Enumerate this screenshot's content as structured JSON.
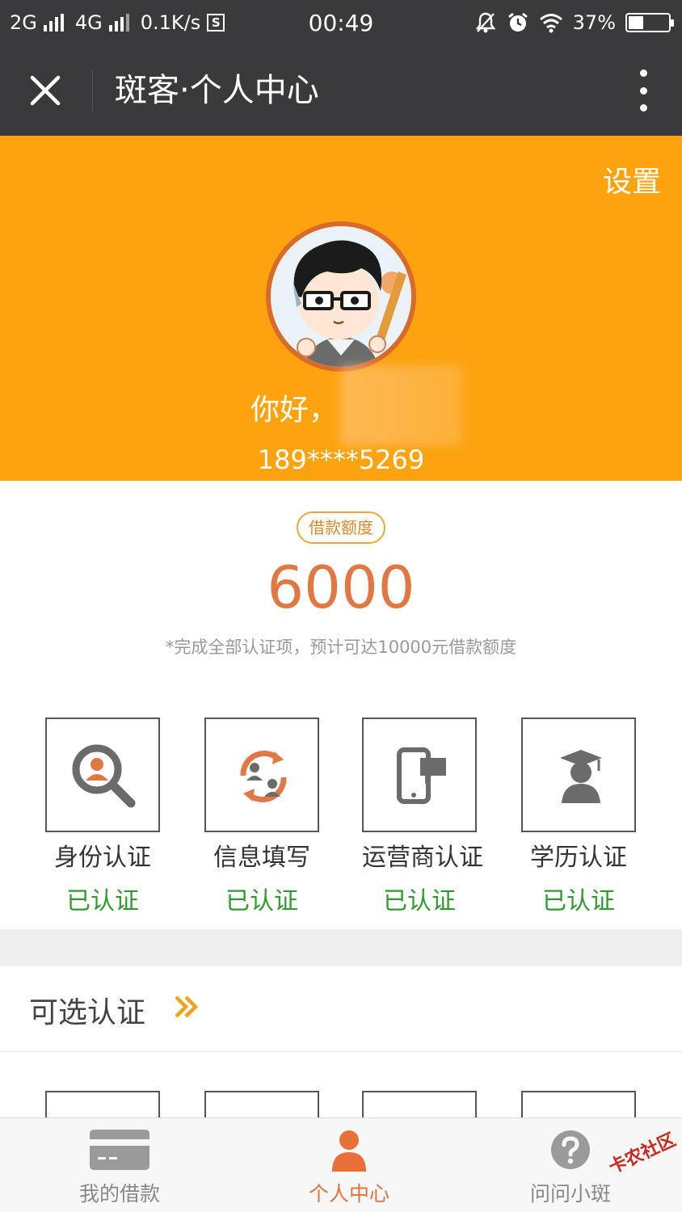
{
  "status_bar": {
    "net1": "2G",
    "net2": "4G",
    "speed": "0.1K/s",
    "s_badge": "S",
    "time": "00:49",
    "battery": "37%",
    "battery_level": 0.37
  },
  "title_bar": {
    "title": "斑客·个人中心"
  },
  "profile": {
    "settings_label": "设置",
    "greeting": "你好，",
    "phone": "189****5269"
  },
  "credit": {
    "quota_label": "借款额度",
    "quota_value": "6000",
    "quota_hint": "*完成全部认证项，预计可达10000元借款额度"
  },
  "certifications": [
    {
      "label": "身份认证",
      "status": "已认证",
      "icon": "identity-search-icon"
    },
    {
      "label": "信息填写",
      "status": "已认证",
      "icon": "info-exchange-icon"
    },
    {
      "label": "运营商认证",
      "status": "已认证",
      "icon": "phone-message-icon"
    },
    {
      "label": "学历认证",
      "status": "已认证",
      "icon": "graduate-icon"
    }
  ],
  "optional": {
    "title": "可选认证"
  },
  "tabbar": {
    "tabs": [
      {
        "label": "我的借款",
        "icon": "card-icon"
      },
      {
        "label": "个人中心",
        "icon": "person-icon"
      },
      {
        "label": "问问小斑",
        "icon": "question-icon"
      }
    ]
  },
  "watermark": "卡农社区",
  "colors": {
    "header_orange": "#fca30f",
    "accent": "#e07844",
    "verified_green": "#2e9a2e",
    "dark_bar": "#3a3a3c"
  }
}
